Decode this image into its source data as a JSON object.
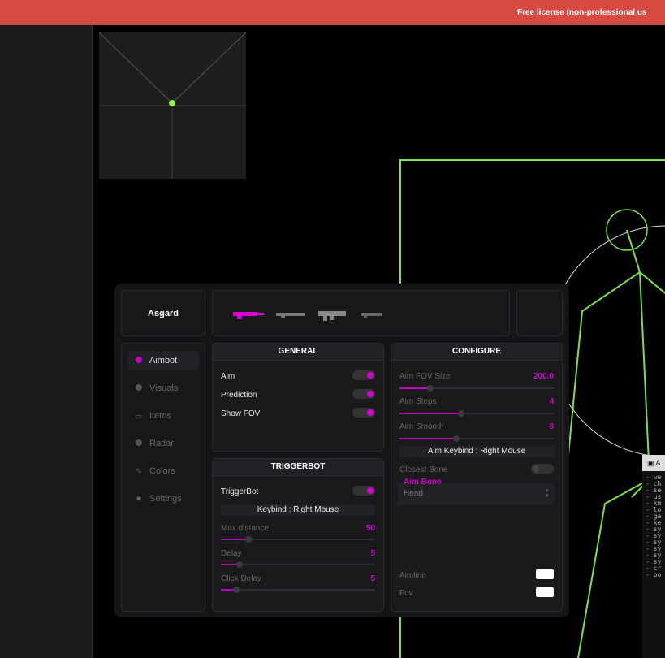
{
  "banner": {
    "text": "Free license (non-professional us"
  },
  "colors": {
    "accent": "#c400c4",
    "skeleton": "#7ee04a",
    "banner": "#d64a42"
  },
  "menu": {
    "brand": "Asgard",
    "weapons": [
      "rifle-icon",
      "sniper-icon",
      "assault-rifle-icon",
      "pistol-icon"
    ],
    "nav": [
      {
        "label": "Aimbot",
        "icon": "target-icon",
        "active": true
      },
      {
        "label": "Visuals",
        "icon": "eye-icon"
      },
      {
        "label": "Items",
        "icon": "box-icon"
      },
      {
        "label": "Radar",
        "icon": "radar-icon"
      },
      {
        "label": "Colors",
        "icon": "brush-icon"
      },
      {
        "label": "Settings",
        "icon": "gear-icon"
      }
    ],
    "general": {
      "title": "GENERAL",
      "aim": "Aim",
      "prediction": "Prediction",
      "show_fov": "Show FOV"
    },
    "triggerbot": {
      "title": "TRIGGERBOT",
      "toggle": "TriggerBot",
      "keybind": "Keybind : Right Mouse",
      "max_distance": {
        "label": "Max distance",
        "value": "50",
        "level": 0.18
      },
      "delay": {
        "label": "Delay",
        "value": "5",
        "level": 0.12
      },
      "click_delay": {
        "label": "Click Delay",
        "value": "5",
        "level": 0.1
      }
    },
    "configure": {
      "title": "CONFIGURE",
      "fov_size": {
        "label": "Aim FOV Size",
        "value": "200.0",
        "level": 0.2
      },
      "aim_steps": {
        "label": "Aim Steps",
        "value": "4",
        "level": 0.4
      },
      "aim_smooth": {
        "label": "Aim Smooth",
        "value": "8",
        "level": 0.37
      },
      "keybind": "Aim Keybind : Right Mouse",
      "closest_bone": "Closest Bone",
      "aim_bone_label": "Aim Bone",
      "aim_bone_value": "Head",
      "aimline": "Aimline",
      "fov": "Fov"
    }
  },
  "console": {
    "title": "A",
    "lines": [
      "- we",
      "- ch",
      "- se",
      "- us",
      "- km",
      "- lo",
      "- ga",
      "- ke",
      "- sy",
      "- sy",
      "- sy",
      "- sy",
      "- sy",
      "- sy",
      "- cr",
      "- bo"
    ]
  }
}
